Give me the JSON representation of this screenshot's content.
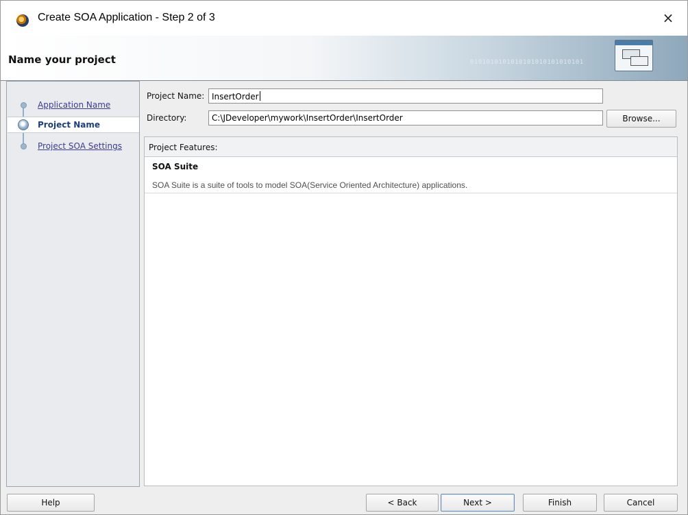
{
  "window": {
    "title": "Create SOA Application - Step 2 of 3",
    "close_icon": "×"
  },
  "banner": {
    "title": "Name your project",
    "binary": "0101010101010101010101010101",
    "icon": "wizard-window-icon"
  },
  "nav": {
    "items": [
      {
        "label": "Application Name",
        "state": "visited"
      },
      {
        "label": "Project Name",
        "state": "current"
      },
      {
        "label": "Project SOA Settings",
        "state": "upcoming"
      }
    ]
  },
  "form": {
    "project_name_label": "Project Name:",
    "project_name_value": "InsertOrder",
    "directory_label": "Directory:",
    "directory_value": "C:\\JDeveloper\\mywork\\InsertOrder\\InsertOrder",
    "browse_label": "Browse..."
  },
  "features": {
    "header": "Project Features:",
    "items": [
      {
        "title": "SOA Suite",
        "description": "SOA Suite is a suite of tools to model SOA(Service Oriented Architecture) applications."
      }
    ]
  },
  "footer": {
    "help": "Help",
    "back": "< Back",
    "next": "Next >",
    "finish": "Finish",
    "cancel": "Cancel"
  },
  "colors": {
    "nav_link": "#3b3b8f",
    "nav_selected": "#1d3f7a",
    "banner_accent": "#8ea8bb"
  }
}
